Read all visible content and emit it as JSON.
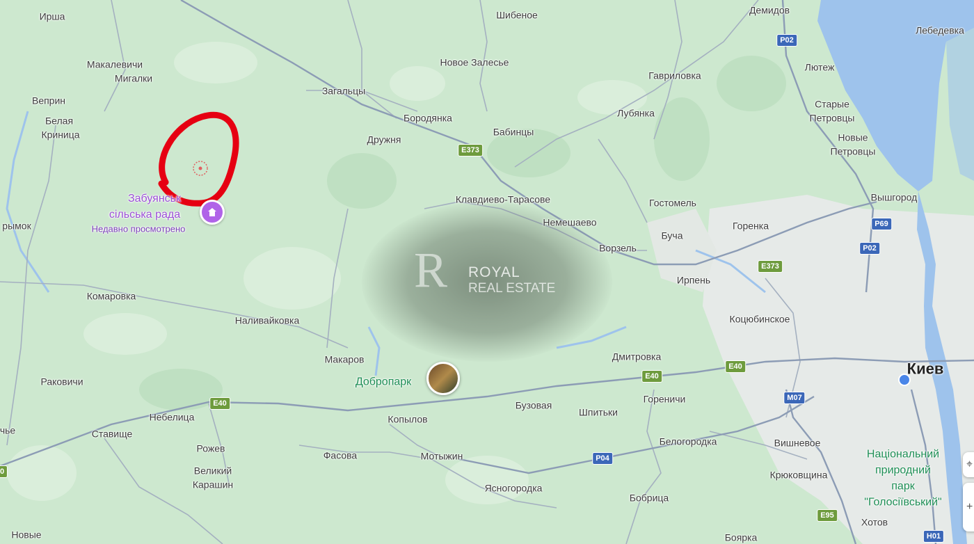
{
  "map": {
    "water_color": "#9ec3ec",
    "land_color": "#cde8cf",
    "urban_color": "#e6eae8",
    "annotation_color": "#e60012",
    "poi_color": "#b063e8",
    "labels": {
      "irsha": "Ирша",
      "makalevichi": "Макалевичи",
      "migalki": "Мигалки",
      "veprin": "Веприн",
      "belaya": "Белая",
      "krinitsa": "Криница",
      "krymok": "рымок",
      "komarovka": "Комаровка",
      "nalivaikovka": "Наливайковка",
      "makarov": "Макаров",
      "rakovichi": "Раковичи",
      "nebelitsa": "Небелица",
      "stavishche": "Ставище",
      "chye": "чье",
      "rozhev": "Рожев",
      "velikiy": "Великий",
      "karashin": "Карашин",
      "novye": "Новые",
      "fasova": "Фасова",
      "kopylov": "Копылов",
      "motyzhin": "Мотыжин",
      "yasnogorodka": "Ясногородка",
      "buzovaya": "Бузовая",
      "shpitki": "Шпитьки",
      "gorenichi": "Гореничи",
      "dmitrovka": "Дмитровка",
      "belogorodka": "Белогородка",
      "bobritsa": "Бобрица",
      "boyarka": "Боярка",
      "vishnevoe": "Вишневое",
      "kryukovshchina": "Крюковщина",
      "khotov": "Хотов",
      "kotsyubinskoe": "Коцюбинское",
      "irpen": "Ирпень",
      "vorzel": "Ворзель",
      "bucha": "Буча",
      "gorenka": "Горенка",
      "gostomel": "Гостомель",
      "nemeshaevo": "Немешаево",
      "klavdievo": "Клавдиево-Тарасове",
      "vyshgorod": "Вышгород",
      "novye_petrovtsy_1": "Новые",
      "novye_petrovtsy_2": "Петровцы",
      "starye_petrovtsy_1": "Старые",
      "starye_petrovtsy_2": "Петровцы",
      "lyutezh": "Лютеж",
      "lebedevka": "Лебедевка",
      "demidov": "Демидов",
      "gavrilovka": "Гавриловка",
      "lubyanka": "Лубянка",
      "babintsy": "Бабинцы",
      "borodyanka": "Бородянка",
      "druzhnya": "Дружня",
      "zagaltsy": "Загальцы",
      "novoe_zalesye": "Новое Залесье",
      "shibenoe": "Шибеное",
      "kiev": "Киев"
    },
    "poi": {
      "name_line1": "Забуянськ",
      "name_line2": "сільська рада",
      "status": "Недавно просмотрено"
    },
    "park_label": "Добропарк",
    "national_park": {
      "line1": "Національний",
      "line2": "природний",
      "line3": "парк",
      "line4": "\"Голосіївський\""
    },
    "shields": {
      "e373_a": "E373",
      "e373_b": "E373",
      "e40_a": "E40",
      "e40_b": "E40",
      "e40_c": "E40",
      "p02_a": "P02",
      "p02_b": "P02",
      "p69": "P69",
      "p04": "P04",
      "m07": "M07",
      "e95": "E95",
      "h01": "H01",
      "edge": "0"
    },
    "watermark": {
      "logo": "R",
      "line1": "ROYAL",
      "line2": "REAL ESTATE"
    },
    "controls": {
      "locate_icon": "crosshair-icon",
      "zoom_icon": "zoom-icon"
    }
  }
}
